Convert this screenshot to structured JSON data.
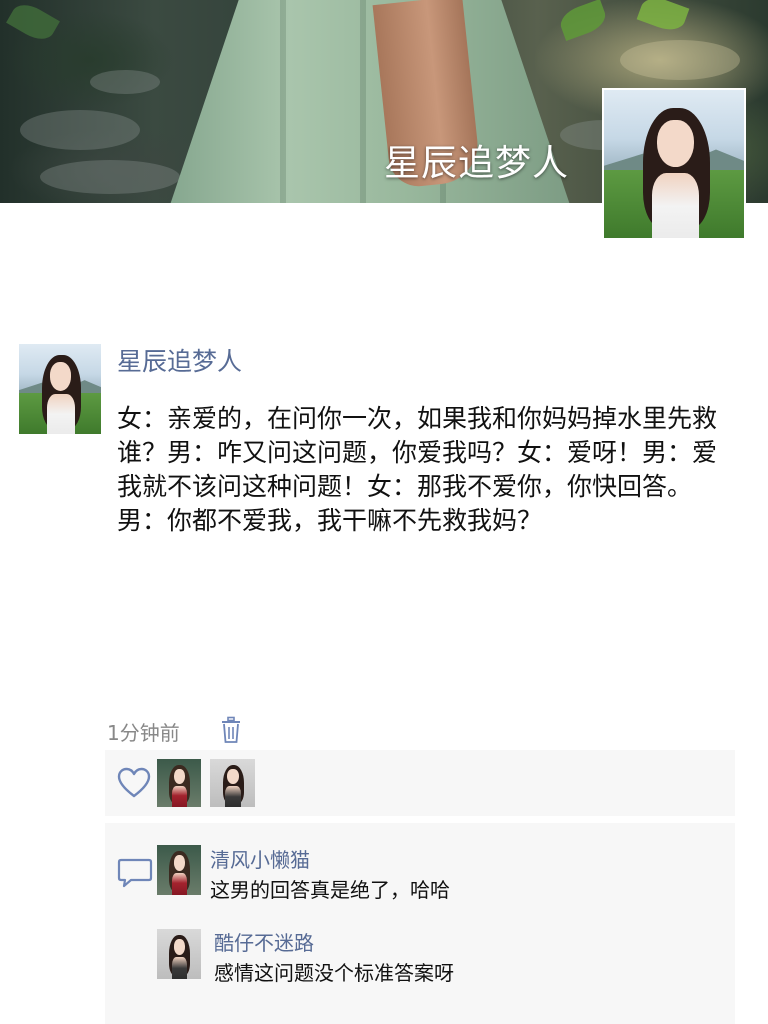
{
  "profile": {
    "cover_name": "星辰追梦人"
  },
  "post": {
    "author": "星辰追梦人",
    "content": "女：亲爱的，在问你一次，如果我和你妈妈掉水里先救谁？男：咋又问这问题，你爱我吗？女：爱呀！男：爱我就不该问这种问题！女：那我不爱你，你快回答。男：你都不爱我，我干嘛不先救我妈？",
    "time": "1分钟前"
  },
  "likes": {
    "icon": "heart-icon",
    "count": 2
  },
  "comments": [
    {
      "name": "清风小懒猫",
      "text": "这男的回答真是绝了，哈哈"
    },
    {
      "name": "酷仔不迷路",
      "text": "感情这问题没个标准答案呀"
    }
  ],
  "colors": {
    "name_link": "#576b95",
    "panel_bg": "#f7f7f7",
    "meta_text": "#888888"
  }
}
